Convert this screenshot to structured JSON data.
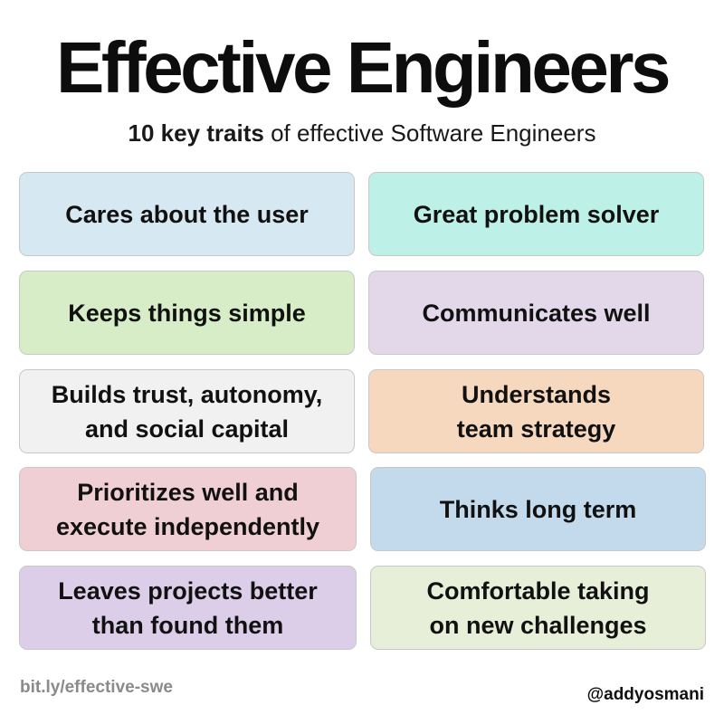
{
  "header": {
    "title": "Effective Engineers",
    "subtitle_strong": "10 key traits",
    "subtitle_rest": " of effective Software Engineers"
  },
  "traits": [
    {
      "label": "Cares about the user",
      "color": "#d6e8f2"
    },
    {
      "label": "Great problem solver",
      "color": "#bdf0e6"
    },
    {
      "label": "Keeps things simple",
      "color": "#d6edc7"
    },
    {
      "label": "Communicates well",
      "color": "#e3d7ea"
    },
    {
      "label": "Builds trust, autonomy,\nand social capital",
      "color": "#f1f1f1"
    },
    {
      "label": "Understands\nteam strategy",
      "color": "#f6d8bf"
    },
    {
      "label": "Prioritizes well and\nexecute independently",
      "color": "#efcfd3"
    },
    {
      "label": "Thinks long term",
      "color": "#c3daec"
    },
    {
      "label": "Leaves projects better\nthan found them",
      "color": "#dccde8"
    },
    {
      "label": "Comfortable taking\non new challenges",
      "color": "#e8efd9"
    }
  ],
  "footer": {
    "link": "bit.ly/effective-swe",
    "handle": "@addyosmani"
  }
}
